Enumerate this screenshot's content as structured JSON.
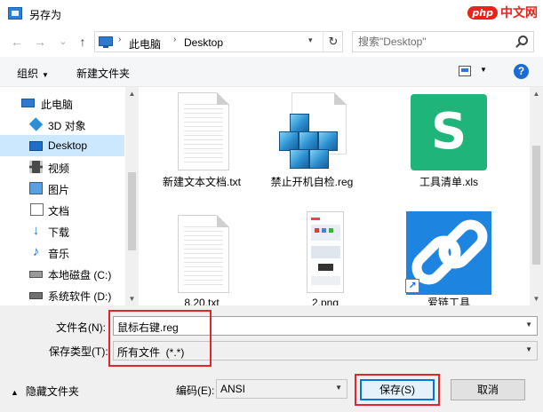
{
  "window": {
    "title": "另存为",
    "brand_badge": "php",
    "brand_text": "中文网"
  },
  "nav": {
    "back_icon": "←",
    "forward_icon": "→",
    "recent_icon": "⌄",
    "up_icon": "↑",
    "breadcrumbs": [
      "此电脑",
      "Desktop"
    ],
    "separator": "›",
    "refresh_icon": "↻",
    "search_placeholder": "搜索\"Desktop\""
  },
  "toolbar": {
    "organize_label": "组织",
    "new_folder_label": "新建文件夹",
    "help_label": "?"
  },
  "sidebar": {
    "items": [
      {
        "label": "此电脑",
        "icon": "computer-icon"
      },
      {
        "label": "3D 对象",
        "icon": "3d-objects-icon"
      },
      {
        "label": "Desktop",
        "icon": "desktop-icon",
        "selected": true
      },
      {
        "label": "视频",
        "icon": "video-icon"
      },
      {
        "label": "图片",
        "icon": "pictures-icon"
      },
      {
        "label": "文档",
        "icon": "documents-icon"
      },
      {
        "label": "下载",
        "icon": "download-icon"
      },
      {
        "label": "音乐",
        "icon": "music-icon"
      },
      {
        "label": "本地磁盘 (C:)",
        "icon": "drive-icon"
      },
      {
        "label": "系统软件 (D:)",
        "icon": "drive-icon"
      }
    ]
  },
  "files": [
    {
      "name": "新建文本文档.txt",
      "type": "text-file-icon"
    },
    {
      "name": "禁止开机自检.reg",
      "type": "registry-file-icon"
    },
    {
      "name": "工具清单.xls",
      "type": "spreadsheet-file-icon"
    },
    {
      "name": "8.20.txt",
      "type": "text-file-icon"
    },
    {
      "name": "2.png",
      "type": "image-file-icon"
    },
    {
      "name": "爱链工具",
      "type": "shortcut-icon"
    }
  ],
  "form": {
    "filename_label": "文件名(N):",
    "filename_value": "鼠标右键.reg",
    "filetype_label": "保存类型(T):",
    "filetype_value": "所有文件  (*.*)",
    "hide_folders_label": "隐藏文件夹",
    "encoding_label": "编码(E):",
    "encoding_value": "ANSI",
    "save_label": "保存(S)",
    "cancel_label": "取消"
  },
  "colors": {
    "highlight_box": "#e0262a",
    "selection": "#cce8ff",
    "primary_border": "#0078d7"
  }
}
